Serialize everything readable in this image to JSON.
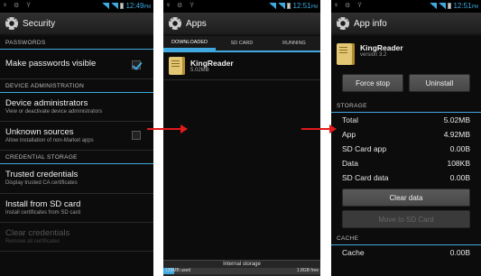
{
  "settings": {
    "status": {
      "time": "12:49",
      "ampm": "PM"
    },
    "title": "Security",
    "sections": {
      "passwords": "PASSWORDS",
      "device_admin": "DEVICE ADMINISTRATION",
      "credential": "CREDENTIAL STORAGE"
    },
    "items": {
      "make_visible": "Make passwords visible",
      "device_admins": {
        "title": "Device administrators",
        "summary": "View or deactivate device administrators"
      },
      "unknown_sources": {
        "title": "Unknown sources",
        "summary": "Allow installation of non-Market apps"
      },
      "trusted": {
        "title": "Trusted credentials",
        "summary": "Display trusted CA certificates"
      },
      "install_sd": {
        "title": "Install from SD card",
        "summary": "Install certificates from SD card"
      },
      "clear": {
        "title": "Clear credentials",
        "summary": "Remove all certificates"
      }
    },
    "make_visible_checked": true,
    "unknown_sources_checked": false
  },
  "apps": {
    "status": {
      "time": "12:51",
      "ampm": "PM"
    },
    "title": "Apps",
    "tabs": [
      "DOWNLOADED",
      "SD CARD",
      "RUNNING"
    ],
    "list": [
      {
        "name": "KingReader",
        "size": "5.02MB"
      }
    ],
    "storage": {
      "label": "Internal storage",
      "used": "139MB used",
      "free": "1.8GB free",
      "used_fraction": 0.07
    }
  },
  "info": {
    "status": {
      "time": "12:51",
      "ampm": "PM"
    },
    "title": "App info",
    "app_name": "KingReader",
    "version": "version 3.2",
    "buttons": {
      "force_stop": "Force stop",
      "uninstall": "Uninstall",
      "clear_data": "Clear data",
      "move_sd": "Move to SD Card"
    },
    "storage_header": "STORAGE",
    "storage_rows": [
      {
        "label": "Total",
        "value": "5.02MB"
      },
      {
        "label": "App",
        "value": "4.92MB"
      },
      {
        "label": "SD Card app",
        "value": "0.00B"
      },
      {
        "label": "Data",
        "value": "108KB"
      },
      {
        "label": "SD Card data",
        "value": "0.00B"
      }
    ],
    "cache_header": "CACHE",
    "cache_row": {
      "label": "Cache",
      "value": "0.00B"
    }
  },
  "colors": {
    "accent": "#3fa9e0",
    "arrow": "#e21a1a",
    "background": "#0c0c0c"
  }
}
